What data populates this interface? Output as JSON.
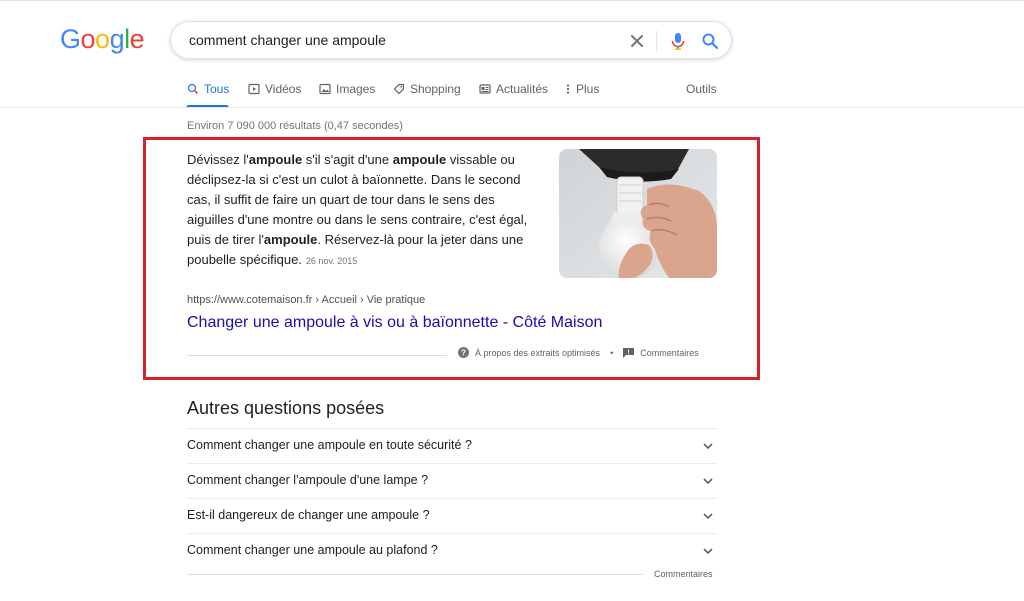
{
  "logo": {
    "letters": [
      {
        "char": "G",
        "color": "#4285f4"
      },
      {
        "char": "o",
        "color": "#ea4335"
      },
      {
        "char": "o",
        "color": "#fbbc05"
      },
      {
        "char": "g",
        "color": "#4285f4"
      },
      {
        "char": "l",
        "color": "#34a853"
      },
      {
        "char": "e",
        "color": "#ea4335"
      }
    ]
  },
  "search": {
    "query": "comment changer une ampoule",
    "clear_icon": "close-icon",
    "voice_icon": "mic-icon",
    "submit_icon": "search-icon"
  },
  "tabs": [
    {
      "label": "Tous",
      "icon": "search-icon",
      "active": true
    },
    {
      "label": "Vidéos",
      "icon": "video-icon",
      "active": false
    },
    {
      "label": "Images",
      "icon": "image-icon",
      "active": false
    },
    {
      "label": "Shopping",
      "icon": "tag-icon",
      "active": false
    },
    {
      "label": "Actualités",
      "icon": "news-icon",
      "active": false
    },
    {
      "label": "Plus",
      "icon": "more-vert-icon",
      "active": false
    }
  ],
  "tools_label": "Outils",
  "stats": "Environ 7 090 000 résultats (0,47 secondes)",
  "snippet": {
    "segments": [
      {
        "text": "Dévissez l'",
        "bold": false
      },
      {
        "text": "ampoule",
        "bold": true
      },
      {
        "text": " s'il s'agit d'une ",
        "bold": false
      },
      {
        "text": "ampoule",
        "bold": true
      },
      {
        "text": " vissable ou déclipsez-la si c'est un culot à baïonnette. Dans le second cas, il suffit de faire un quart de tour dans le sens des aiguilles d'une montre ou dans le sens contraire, c'est égal, puis de tirer l'",
        "bold": false
      },
      {
        "text": "ampoule",
        "bold": true
      },
      {
        "text": ". Réservez-là pour la jeter dans une poubelle spécifique.",
        "bold": false
      }
    ],
    "date": "26 nov. 2015",
    "url": "https://www.cotemaison.fr › Accueil › Vie pratique",
    "title": "Changer une ampoule à vis ou à baïonnette - Côté Maison",
    "about_label": "À propos des extraits optimisés",
    "separator": "•",
    "feedback_label": "Commentaires",
    "highlight_color": "#d6232b"
  },
  "paa": {
    "title": "Autres questions posées",
    "questions": [
      "Comment changer une ampoule en toute sécurité ?",
      "Comment changer l'ampoule d'une lampe ?",
      "Est-il dangereux de changer une ampoule ?",
      "Comment changer une ampoule au plafond ?"
    ],
    "feedback_label": "Commentaires"
  }
}
